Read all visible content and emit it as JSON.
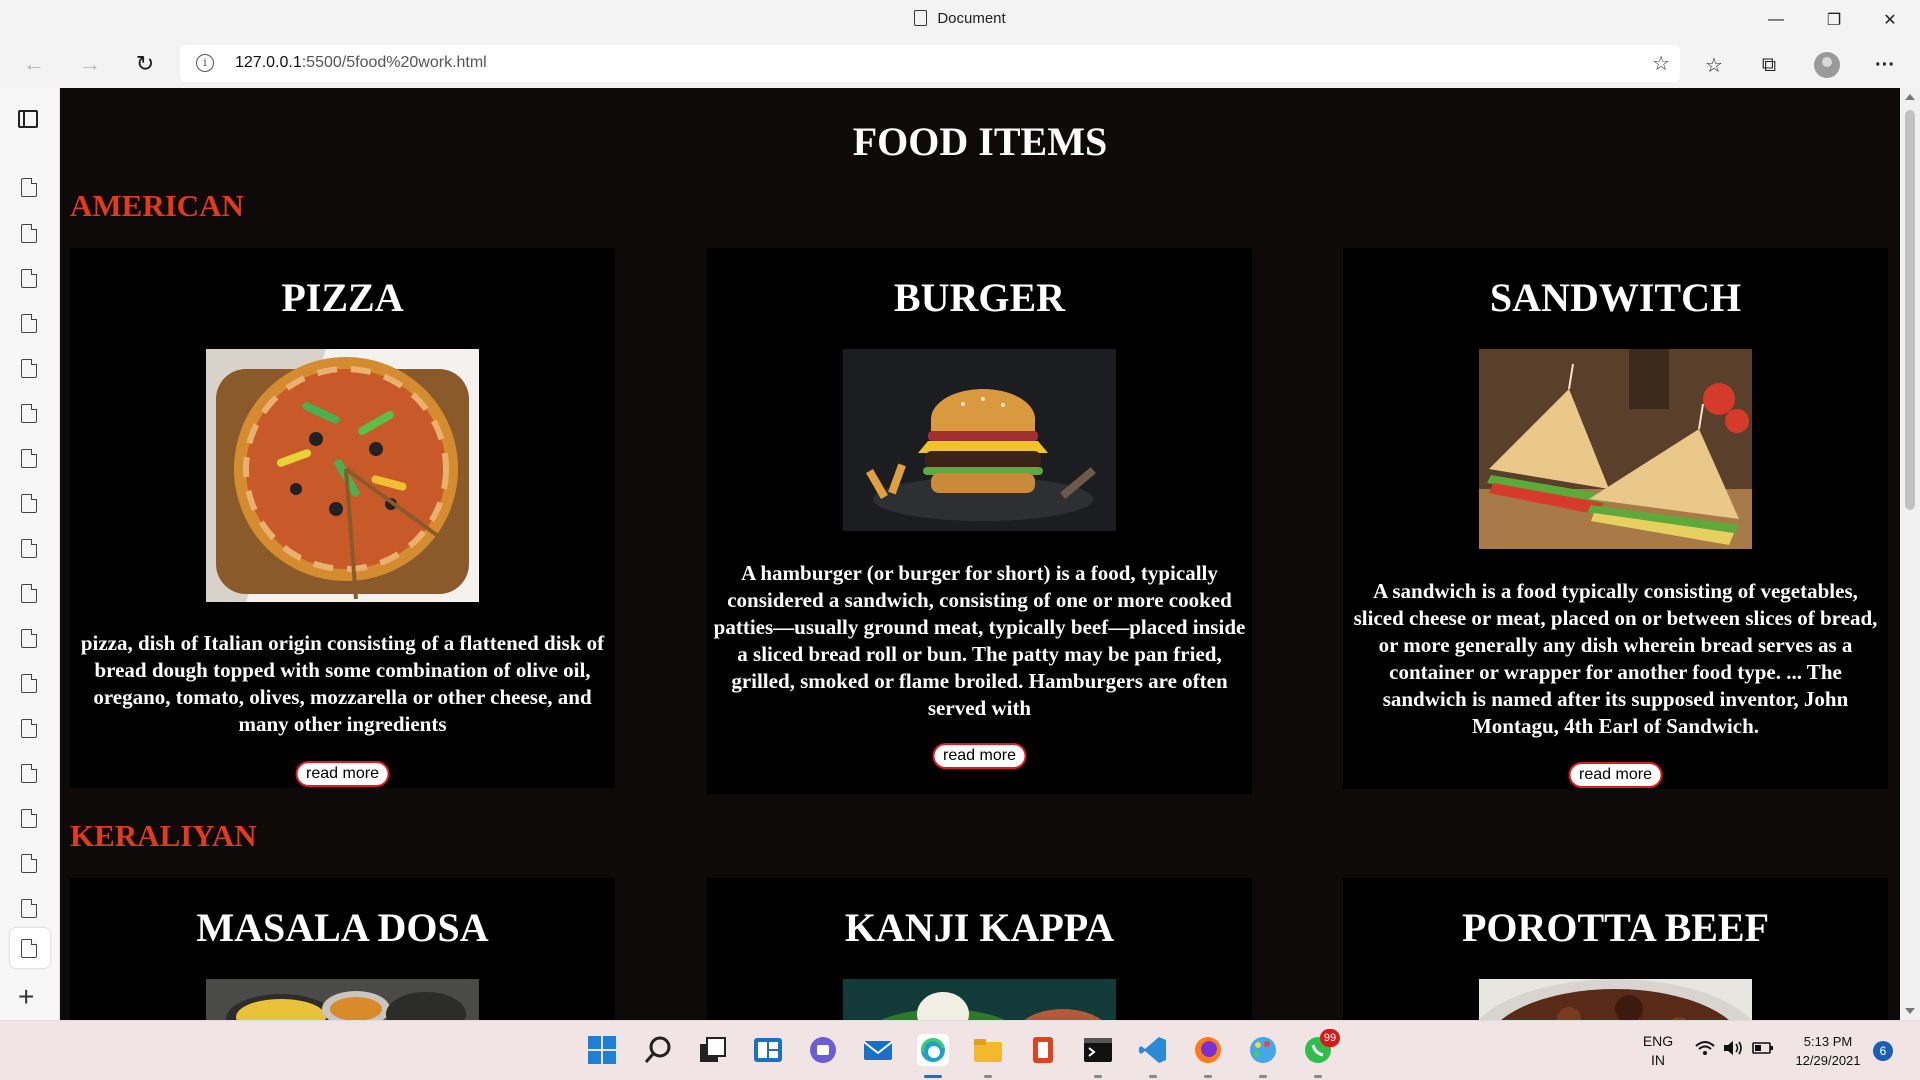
{
  "window": {
    "title": "Document",
    "minimize_glyph": "—",
    "maximize_glyph": "❐",
    "close_glyph": "✕"
  },
  "browser": {
    "url_host": "127.0.0.1",
    "url_rest": ":5500/5food%20work.html",
    "back_glyph": "←",
    "forward_glyph": "→",
    "refresh_glyph": "↻",
    "menu_glyph": "···"
  },
  "page": {
    "title": "FOOD ITEMS",
    "sections": [
      {
        "title": "AMERICAN",
        "cards": [
          {
            "name": "PIZZA",
            "description": "pizza, dish of Italian origin consisting of a flattened disk of bread dough topped with some combination of olive oil, oregano, tomato, olives, mozzarella or other cheese, and many other ingredients",
            "button": "read more"
          },
          {
            "name": "BURGER",
            "description": "A hamburger (or burger for short) is a food, typically considered a sandwich, consisting of one or more cooked patties—usually ground meat, typically beef—placed inside a sliced bread roll or bun. The patty may be pan fried, grilled, smoked or flame broiled. Hamburgers are often served with",
            "button": "read more"
          },
          {
            "name": "SANDWITCH",
            "description": "A sandwich is a food typically consisting of vegetables, sliced cheese or meat, placed on or between slices of bread, or more generally any dish wherein bread serves as a container or wrapper for another food type. ... The sandwich is named after its supposed inventor, John Montagu, 4th Earl of Sandwich.",
            "button": "read more"
          }
        ]
      },
      {
        "title": "KERALIYAN",
        "cards": [
          {
            "name": "MASALA DOSA"
          },
          {
            "name": "KANJI KAPPA"
          },
          {
            "name": "POROTTA BEEF"
          }
        ]
      }
    ]
  },
  "taskbar": {
    "language": "ENG",
    "region": "IN",
    "time": "5:13 PM",
    "date": "12/29/2021",
    "notifications": "6",
    "whatsapp_badge": "99"
  }
}
